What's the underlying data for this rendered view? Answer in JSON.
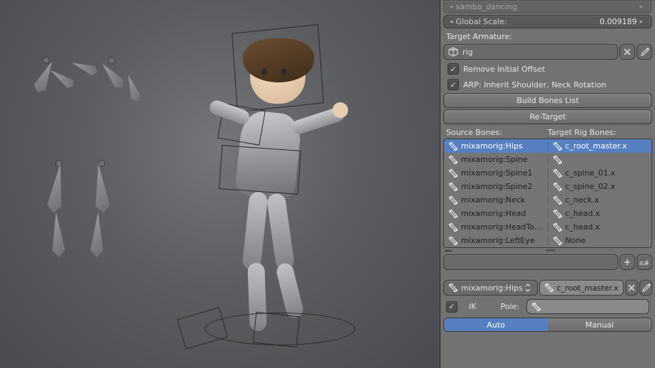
{
  "topfield": {
    "label": "samba_dancing"
  },
  "global_scale": {
    "label": "Global Scale:",
    "value": "0.009189"
  },
  "target_armature": {
    "label": "Target Armature:",
    "value": "rig"
  },
  "checks": {
    "remove_offset": "Remove Initial Offset",
    "arp_inherit": "ARP: Inherit Shoulder, Neck Rotation"
  },
  "buttons": {
    "build": "Build Bones List",
    "retarget": "Re-Target",
    "auto": "Auto",
    "manual": "Manual"
  },
  "list_header": {
    "src": "Source Bones:",
    "tgt": "Target Rig Bones:"
  },
  "bones": [
    {
      "src": "mixamorig:Hips",
      "tgt": "c_root_master.x",
      "selected": true
    },
    {
      "src": "mixamorig:Spine",
      "tgt": ""
    },
    {
      "src": "mixamorig:Spine1",
      "tgt": "c_spine_01.x"
    },
    {
      "src": "mixamorig:Spine2",
      "tgt": "c_spine_02.x"
    },
    {
      "src": "mixamorig:Neck",
      "tgt": "c_neck.x"
    },
    {
      "src": "mixamorig:Head",
      "tgt": "c_head.x"
    },
    {
      "src": "mixamorig:HeadTo…",
      "tgt": "c_head.x"
    },
    {
      "src": "mixamorig:LeftEye",
      "tgt": "None"
    }
  ],
  "filter_placeholder": "",
  "active": {
    "src": "mixamorig:Hips",
    "tgt": "c_root_master.x"
  },
  "ik": {
    "label": "IK",
    "pole": "Pole:"
  }
}
